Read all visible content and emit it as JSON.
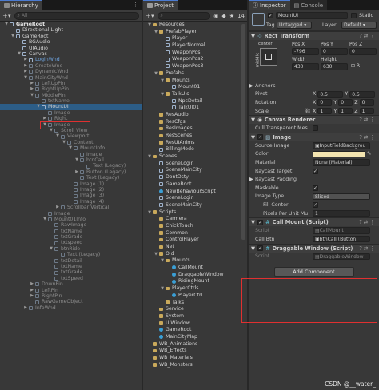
{
  "hierarchy": {
    "tab": "Hierarchy",
    "search_placeholder": "All",
    "rows": [
      {
        "d": 0,
        "a": "▼",
        "t": "GameRoot",
        "s": "bold",
        "i": "cube"
      },
      {
        "d": 1,
        "a": "",
        "t": "Directional Light",
        "s": "",
        "i": "cube"
      },
      {
        "d": 1,
        "a": "▼",
        "t": "GameRoot",
        "s": "",
        "i": "cube"
      },
      {
        "d": 2,
        "a": "",
        "t": "BGAudio",
        "s": "",
        "i": "cube"
      },
      {
        "d": 2,
        "a": "",
        "t": "UIAudio",
        "s": "",
        "i": "cube"
      },
      {
        "d": 2,
        "a": "▼",
        "t": "Canvas",
        "s": "",
        "i": "cube"
      },
      {
        "d": 3,
        "a": "▶",
        "t": "LoginWnd",
        "s": "blue",
        "i": "cube"
      },
      {
        "d": 3,
        "a": "▶",
        "t": "CreateWnd",
        "s": "dim",
        "i": "cube-dim"
      },
      {
        "d": 3,
        "a": "▶",
        "t": "DynamicWnd",
        "s": "dim",
        "i": "cube-dim"
      },
      {
        "d": 3,
        "a": "▼",
        "t": "MainCityWnd",
        "s": "dim",
        "i": "cube-dim"
      },
      {
        "d": 4,
        "a": "▶",
        "t": "LeftUpPin",
        "s": "dim",
        "i": "cube-dim"
      },
      {
        "d": 4,
        "a": "▶",
        "t": "RightUpPin",
        "s": "dim",
        "i": "cube-dim"
      },
      {
        "d": 4,
        "a": "▼",
        "t": "MiddlePin",
        "s": "dim",
        "i": "cube-dim"
      },
      {
        "d": 5,
        "a": "",
        "t": "txtName",
        "s": "dim",
        "i": "cube-dim"
      },
      {
        "d": 5,
        "a": "▼",
        "t": "MountUI",
        "s": "sel",
        "i": "cube"
      },
      {
        "d": 6,
        "a": "",
        "t": "Image",
        "s": "dim",
        "i": "cube-dim"
      },
      {
        "d": 6,
        "a": "▶",
        "t": "Right",
        "s": "dim",
        "i": "cube-dim"
      },
      {
        "d": 6,
        "a": "▼",
        "t": "Image",
        "s": "dim",
        "i": "cube-dim"
      },
      {
        "d": 7,
        "a": "▼",
        "t": "Scroll View",
        "s": "dim",
        "i": "cube-dim"
      },
      {
        "d": 8,
        "a": "▼",
        "t": "Viewport",
        "s": "dim",
        "i": "cube-dim"
      },
      {
        "d": 9,
        "a": "▼",
        "t": "Content",
        "s": "dim",
        "i": "cube-dim"
      },
      {
        "d": 10,
        "a": "▼",
        "t": "MountInfo",
        "s": "dim",
        "i": "cube-dim"
      },
      {
        "d": 11,
        "a": "",
        "t": "Image",
        "s": "dim",
        "i": "cube-dim"
      },
      {
        "d": 11,
        "a": "▼",
        "t": "btnCall",
        "s": "dim",
        "i": "cube-dim"
      },
      {
        "d": 12,
        "a": "",
        "t": "Text (Legacy)",
        "s": "dim",
        "i": "cube-dim"
      },
      {
        "d": 11,
        "a": "▶",
        "t": "Button (Legacy)",
        "s": "dim",
        "i": "cube-dim"
      },
      {
        "d": 11,
        "a": "",
        "t": "Text (Legacy)",
        "s": "dim",
        "i": "cube-dim"
      },
      {
        "d": 10,
        "a": "",
        "t": "Image (1)",
        "s": "dim",
        "i": "cube-dim"
      },
      {
        "d": 10,
        "a": "",
        "t": "Image (2)",
        "s": "dim",
        "i": "cube-dim"
      },
      {
        "d": 10,
        "a": "",
        "t": "Image (3)",
        "s": "dim",
        "i": "cube-dim"
      },
      {
        "d": 10,
        "a": "",
        "t": "Image (4)",
        "s": "dim",
        "i": "cube-dim"
      },
      {
        "d": 8,
        "a": "▶",
        "t": "Scrollbar Vertical",
        "s": "dim",
        "i": "cube-dim"
      },
      {
        "d": 6,
        "a": "",
        "t": "Image",
        "s": "dim",
        "i": "cube-dim"
      },
      {
        "d": 6,
        "a": "▼",
        "t": "Mount01Info",
        "s": "dim",
        "i": "cube-dim"
      },
      {
        "d": 7,
        "a": "",
        "t": "RawImage",
        "s": "dim",
        "i": "cube-dim"
      },
      {
        "d": 7,
        "a": "",
        "t": "txtName",
        "s": "dim",
        "i": "cube-dim"
      },
      {
        "d": 7,
        "a": "",
        "t": "txtGrade",
        "s": "dim",
        "i": "cube-dim"
      },
      {
        "d": 7,
        "a": "",
        "t": "txtspeed",
        "s": "dim",
        "i": "cube-dim"
      },
      {
        "d": 7,
        "a": "▼",
        "t": "btnRide",
        "s": "dim",
        "i": "cube-dim"
      },
      {
        "d": 8,
        "a": "",
        "t": "Text (Legacy)",
        "s": "dim",
        "i": "cube-dim"
      },
      {
        "d": 7,
        "a": "",
        "t": "txtDetail",
        "s": "dim",
        "i": "cube-dim"
      },
      {
        "d": 7,
        "a": "",
        "t": "txtName",
        "s": "dim",
        "i": "cube-dim"
      },
      {
        "d": 7,
        "a": "",
        "t": "txtGrade",
        "s": "dim",
        "i": "cube-dim"
      },
      {
        "d": 7,
        "a": "",
        "t": "txtSpeed",
        "s": "dim",
        "i": "cube-dim"
      },
      {
        "d": 4,
        "a": "▶",
        "t": "DownPin",
        "s": "dim",
        "i": "cube-dim"
      },
      {
        "d": 4,
        "a": "▶",
        "t": "LeftPin",
        "s": "dim",
        "i": "cube-dim"
      },
      {
        "d": 4,
        "a": "▶",
        "t": "RightPin",
        "s": "dim",
        "i": "cube-dim"
      },
      {
        "d": 4,
        "a": "",
        "t": "RawGameObject",
        "s": "dim",
        "i": "cube-dim"
      },
      {
        "d": 3,
        "a": "▶",
        "t": "InfoWnd",
        "s": "dim",
        "i": "cube-dim"
      }
    ]
  },
  "project": {
    "tab": "Project",
    "badge": "14",
    "rows": [
      {
        "d": 0,
        "a": "▼",
        "t": "Resources",
        "i": "folder"
      },
      {
        "d": 1,
        "a": "▼",
        "t": "PrefabPlayer",
        "i": "folder"
      },
      {
        "d": 2,
        "a": "",
        "t": "Player",
        "i": "cube"
      },
      {
        "d": 2,
        "a": "",
        "t": "PlayerNormal",
        "i": "cube"
      },
      {
        "d": 2,
        "a": "",
        "t": "WeaponPos",
        "i": "cube"
      },
      {
        "d": 2,
        "a": "",
        "t": "WeaponPos2",
        "i": "cube"
      },
      {
        "d": 2,
        "a": "",
        "t": "WeaponPos3",
        "i": "cube"
      },
      {
        "d": 1,
        "a": "▼",
        "t": "Prefabs",
        "i": "folder"
      },
      {
        "d": 2,
        "a": "▼",
        "t": "Mounts",
        "i": "folder"
      },
      {
        "d": 3,
        "a": "",
        "t": "Mount01",
        "i": "cube"
      },
      {
        "d": 2,
        "a": "▼",
        "t": "TalkUIs",
        "i": "folder"
      },
      {
        "d": 3,
        "a": "",
        "t": "NpcDetail",
        "i": "cube"
      },
      {
        "d": 3,
        "a": "",
        "t": "TalkUI01",
        "i": "cube"
      },
      {
        "d": 1,
        "a": "",
        "t": "ResAudio",
        "i": "folder"
      },
      {
        "d": 1,
        "a": "",
        "t": "ResCfgs",
        "i": "folder"
      },
      {
        "d": 1,
        "a": "",
        "t": "ResImages",
        "i": "folder"
      },
      {
        "d": 1,
        "a": "",
        "t": "ResScenes",
        "i": "folder"
      },
      {
        "d": 1,
        "a": "",
        "t": "ResUIAnims",
        "i": "folder"
      },
      {
        "d": 1,
        "a": "",
        "t": "BillingMode",
        "i": "cube"
      },
      {
        "d": 0,
        "a": "▼",
        "t": "Scenes",
        "i": "folder"
      },
      {
        "d": 1,
        "a": "",
        "t": "SceneLogin",
        "i": "cube"
      },
      {
        "d": 1,
        "a": "",
        "t": "SceneMainCity",
        "i": "cube"
      },
      {
        "d": 1,
        "a": "",
        "t": "DontDsty",
        "i": "cube"
      },
      {
        "d": 1,
        "a": "",
        "t": "GameRoot",
        "i": "cube"
      },
      {
        "d": 1,
        "a": "",
        "t": "NewBehaviourScript",
        "i": "script"
      },
      {
        "d": 1,
        "a": "",
        "t": "SceneLogin",
        "i": "cube"
      },
      {
        "d": 1,
        "a": "",
        "t": "SceneMainCity",
        "i": "cube"
      },
      {
        "d": 0,
        "a": "▼",
        "t": "Scripts",
        "i": "folder"
      },
      {
        "d": 1,
        "a": "",
        "t": "Carmera",
        "i": "folder"
      },
      {
        "d": 1,
        "a": "",
        "t": "ChickTouch",
        "i": "folder"
      },
      {
        "d": 1,
        "a": "",
        "t": "Common",
        "i": "folder"
      },
      {
        "d": 1,
        "a": "",
        "t": "ControlPlayer",
        "i": "folder"
      },
      {
        "d": 1,
        "a": "",
        "t": "Net",
        "i": "folder"
      },
      {
        "d": 1,
        "a": "▼",
        "t": "Old",
        "i": "folder"
      },
      {
        "d": 2,
        "a": "▼",
        "t": "Mounts",
        "i": "folder"
      },
      {
        "d": 3,
        "a": "",
        "t": "CallMount",
        "i": "script"
      },
      {
        "d": 3,
        "a": "",
        "t": "DraggableWindow",
        "i": "script"
      },
      {
        "d": 3,
        "a": "",
        "t": "RidingMount",
        "i": "script"
      },
      {
        "d": 2,
        "a": "▼",
        "t": "PlayerCtrls",
        "i": "folder"
      },
      {
        "d": 3,
        "a": "",
        "t": "PlayerCtrl",
        "i": "script"
      },
      {
        "d": 2,
        "a": "",
        "t": "Talks",
        "i": "folder"
      },
      {
        "d": 1,
        "a": "",
        "t": "Service",
        "i": "folder"
      },
      {
        "d": 1,
        "a": "",
        "t": "System",
        "i": "folder"
      },
      {
        "d": 1,
        "a": "",
        "t": "UIWindow",
        "i": "folder"
      },
      {
        "d": 1,
        "a": "",
        "t": "GameRoot",
        "i": "script"
      },
      {
        "d": 1,
        "a": "",
        "t": "MainCityMap",
        "i": "script"
      },
      {
        "d": 0,
        "a": "",
        "t": "WB_Animations",
        "i": "folder"
      },
      {
        "d": 0,
        "a": "",
        "t": "WB_Effects",
        "i": "folder"
      },
      {
        "d": 0,
        "a": "",
        "t": "WB_Materials",
        "i": "folder"
      },
      {
        "d": 0,
        "a": "",
        "t": "WB_Monsters",
        "i": "folder"
      }
    ]
  },
  "inspector": {
    "tab1": "Inspector",
    "tab2": "Console",
    "object_name": "MountUI",
    "static_label": "Static",
    "tag_label": "Tag",
    "tag_value": "Untagged",
    "layer_label": "Layer",
    "layer_value": "Default",
    "rect_transform": {
      "title": "Rect Transform",
      "anchor_h": "center",
      "anchor_v": "middle",
      "posx_label": "Pos X",
      "posy_label": "Pos Y",
      "posz_label": "Pos Z",
      "posx": "-796",
      "posy": "0",
      "posz": "0",
      "width_label": "Width",
      "height_label": "Height",
      "width": "430",
      "height": "630",
      "anchors": "Anchors",
      "pivot": "Pivot",
      "pivot_x": "0.5",
      "pivot_y": "0.5",
      "rotation": "Rotation",
      "rot_x": "0",
      "rot_y": "0",
      "rot_z": "0",
      "scale": "Scale",
      "scale_x": "1",
      "scale_y": "1",
      "scale_z": "1",
      "x": "X",
      "y": "Y",
      "z": "Z"
    },
    "canvas_renderer": {
      "title": "Canvas Renderer",
      "cull_label": "Cull Transparent Mes"
    },
    "image": {
      "title": "Image",
      "source_label": "Source Image",
      "source_value": "InputFieldBackgrou",
      "color_label": "Color",
      "material_label": "Material",
      "material_value": "None (Material)",
      "raycast_target": "Raycast Target",
      "raycast_padding": "Raycast Padding",
      "maskable": "Maskable",
      "image_type_label": "Image Type",
      "image_type": "Sliced",
      "fill_center": "Fill Center",
      "ppu_label": "Pixels Per Unit Mu",
      "ppu_value": "1"
    },
    "call_mount": {
      "title": "Call Mount (Script)",
      "script_label": "Script",
      "script_value": "CallMount",
      "btn_label": "Call Btn",
      "btn_value": "btnCall (Button)"
    },
    "draggable": {
      "title": "Draggable Window (Script)",
      "script_label": "Script",
      "script_value": "DraggableWindow"
    },
    "add_component": "Add Component"
  },
  "watermark": "CSDN @__water_",
  "colors": {
    "selection": "#2c5d87",
    "highlight_box": "#e03030",
    "panel": "#383838"
  }
}
